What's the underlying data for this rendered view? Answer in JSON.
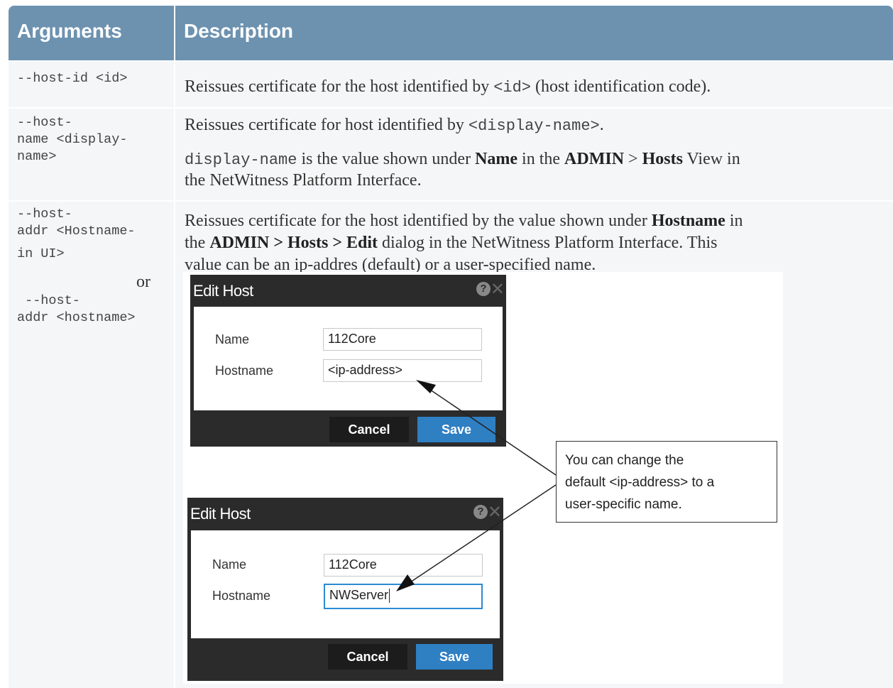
{
  "table": {
    "headers": {
      "arguments": "Arguments",
      "description": "Description"
    },
    "rows": [
      {
        "argument": "--host-id <id>",
        "description": {
          "t1": "Reissues certificate for the host identified by ",
          "code": "<id>",
          "t2": " (host identification code)."
        }
      },
      {
        "argument_lines": [
          "--host-",
          "name <display-",
          "name>"
        ],
        "description": {
          "p1_text": "Reissues certificate for host identified by ",
          "p1_code": "<display-name>",
          "p1_end": ".",
          "p2_code": "display-name",
          "p2_t1": " is the value shown under ",
          "p2_b1": "Name",
          "p2_t2": " in the ",
          "p2_b2": "ADMIN",
          "p2_t3": " > ",
          "p2_b3": "Hosts",
          "p2_t4": " View in",
          "p2_line2": "the NetWitness Platform Interface."
        }
      },
      {
        "argument_lines_1": [
          "--host-",
          "addr <Hostname-",
          "in UI>"
        ],
        "or": "or",
        "argument_lines_2": [
          " --host-",
          "addr <hostname>"
        ],
        "description": {
          "l1_t1": "Reissues certificate for the host identified by the value shown under ",
          "l1_b1": "Hostname",
          "l1_t2": " in",
          "l2_t1": "the ",
          "l2_b1": "ADMIN > Hosts > Edit",
          "l2_t2": " dialog in the NetWitness Platform Interface. This",
          "l3": "value can be an ip-addres (default) or a user-specified name."
        }
      }
    ]
  },
  "figure": {
    "dialog1": {
      "title": "Edit Host",
      "help": "?",
      "close": "✕",
      "name_label": "Name",
      "name_value": "112Core",
      "hostname_label": "Hostname",
      "hostname_value": "<ip-address>",
      "cancel": "Cancel",
      "save": "Save"
    },
    "dialog2": {
      "title": "Edit Host",
      "help": "?",
      "close": "✕",
      "name_label": "Name",
      "name_value": "112Core",
      "hostname_label": "Hostname",
      "hostname_value": "NWServer",
      "cancel": "Cancel",
      "save": "Save"
    },
    "callout_lines": [
      "You can change the",
      "default <ip-address> to a",
      "user-specific name."
    ]
  }
}
